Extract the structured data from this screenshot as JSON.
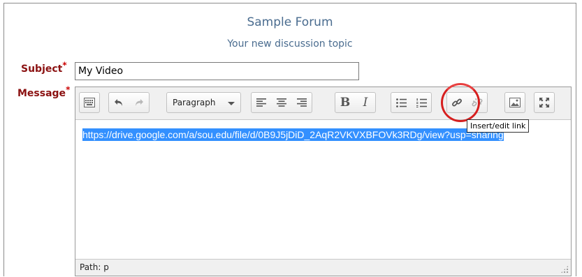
{
  "forum": {
    "title": "Sample Forum",
    "subtitle": "Your new discussion topic"
  },
  "form": {
    "subject_label": "Subject",
    "message_label": "Message",
    "required_mark": "*",
    "subject_value": "My Video"
  },
  "editor": {
    "format_dropdown": "Paragraph",
    "content": "https://drive.google.com/a/sou.edu/file/d/0B9J5jDiD_2AqR2VKVXBFOVk3RDg/view?usp=sharing",
    "status_path": "Path: p",
    "tooltip": "Insert/edit link",
    "toolbar_icons": [
      "kitchen-sink-icon",
      "undo-icon",
      "redo-icon",
      "align-left-icon",
      "align-center-icon",
      "align-right-icon",
      "bold-icon",
      "italic-icon",
      "bullet-list-icon",
      "numbered-list-icon",
      "link-icon",
      "unlink-icon",
      "image-icon",
      "fullscreen-icon"
    ],
    "bold_glyph": "B",
    "italic_glyph": "I"
  },
  "colors": {
    "title": "#4a6c8f",
    "label": "#8b1111",
    "selection": "#3390ff",
    "highlight_ring": "#d61f1f"
  }
}
